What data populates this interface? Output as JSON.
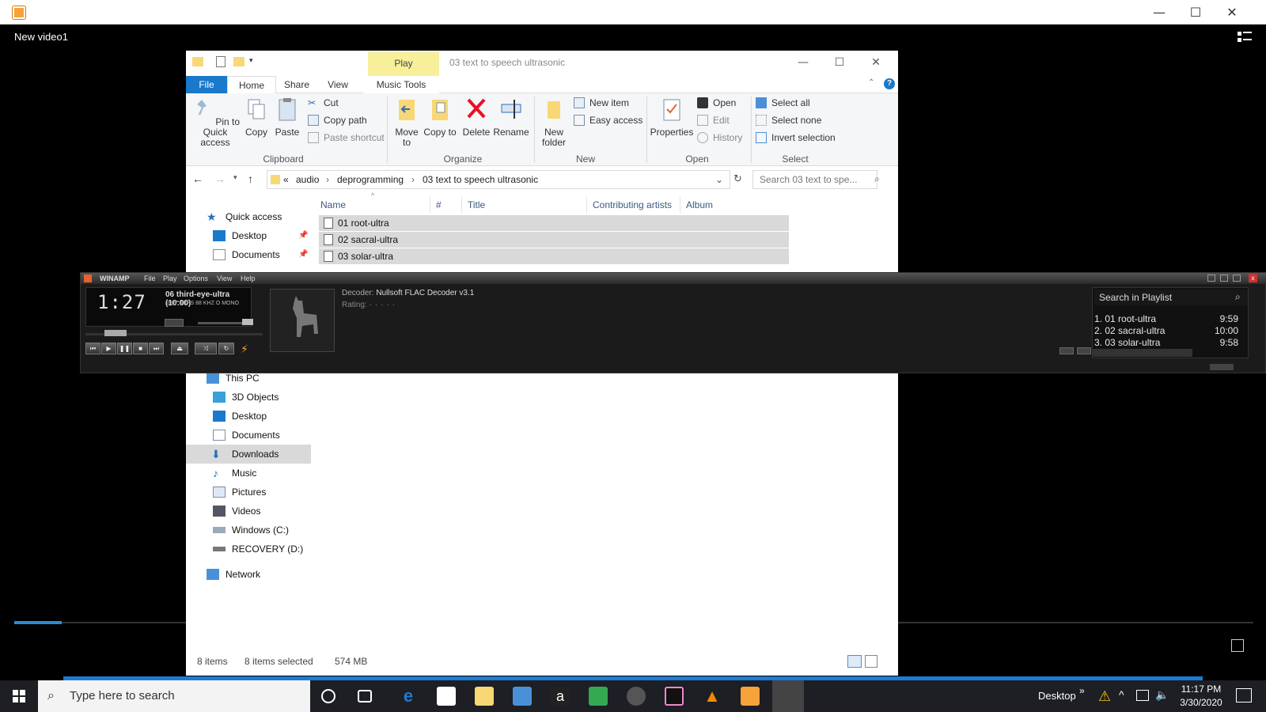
{
  "app": {
    "video_title": "New video1"
  },
  "explorer": {
    "title": "03 text to speech ultrasonic",
    "context_tab": "Play",
    "tabs": [
      "File",
      "Home",
      "Share",
      "View",
      "Music Tools"
    ],
    "clipboard": {
      "pin": "Pin to Quick access",
      "copy": "Copy",
      "paste": "Paste",
      "cut": "Cut",
      "copy_path": "Copy path",
      "paste_shortcut": "Paste shortcut",
      "group": "Clipboard"
    },
    "organize": {
      "move_to": "Move to",
      "copy_to": "Copy to",
      "delete": "Delete",
      "rename": "Rename",
      "group": "Organize"
    },
    "new": {
      "new_folder": "New folder",
      "new_item": "New item",
      "easy_access": "Easy access",
      "group": "New"
    },
    "open": {
      "properties": "Properties",
      "open": "Open",
      "edit": "Edit",
      "history": "History",
      "group": "Open"
    },
    "select": {
      "select_all": "Select all",
      "select_none": "Select none",
      "invert": "Invert selection",
      "group": "Select"
    },
    "breadcrumb": [
      "«",
      "audio",
      "deprogramming",
      "03 text to speech ultrasonic"
    ],
    "search_placeholder": "Search 03 text to spe...",
    "columns": [
      "Name",
      "#",
      "Title",
      "Contributing artists",
      "Album"
    ],
    "files": [
      "01 root-ultra",
      "02 sacral-ultra",
      "03 solar-ultra"
    ],
    "nav_top": [
      "Quick access",
      "Desktop",
      "Documents"
    ],
    "nav_pc": [
      "This PC",
      "3D Objects",
      "Desktop",
      "Documents",
      "Downloads",
      "Music",
      "Pictures",
      "Videos",
      "Windows (C:)",
      "RECOVERY (D:)",
      "Network"
    ],
    "status": {
      "count": "8 items",
      "selected": "8 items selected",
      "size": "574 MB"
    }
  },
  "winamp": {
    "title": "WINAMP",
    "menu": [
      "File",
      "Play",
      "Options",
      "View",
      "Help"
    ],
    "time": "1:27",
    "track": "06 third-eye-ultra (10:00)",
    "stats": "1007 KBPS  88 KHZ  O MONO",
    "decoder_label": "Decoder:",
    "decoder": "Nullsoft FLAC Decoder v3.1",
    "rating_label": "Rating:",
    "playlist_search": "Search in Playlist",
    "playlist": [
      {
        "title": "1. 01 root-ultra",
        "dur": "9:59"
      },
      {
        "title": "2. 02 sacral-ultra",
        "dur": "10:00"
      },
      {
        "title": "3. 03 solar-ultra",
        "dur": "9:58"
      }
    ]
  },
  "taskbar": {
    "search_placeholder": "Type here to search",
    "desktop_label": "Desktop",
    "time": "11:17 PM",
    "date": "3/30/2020"
  }
}
